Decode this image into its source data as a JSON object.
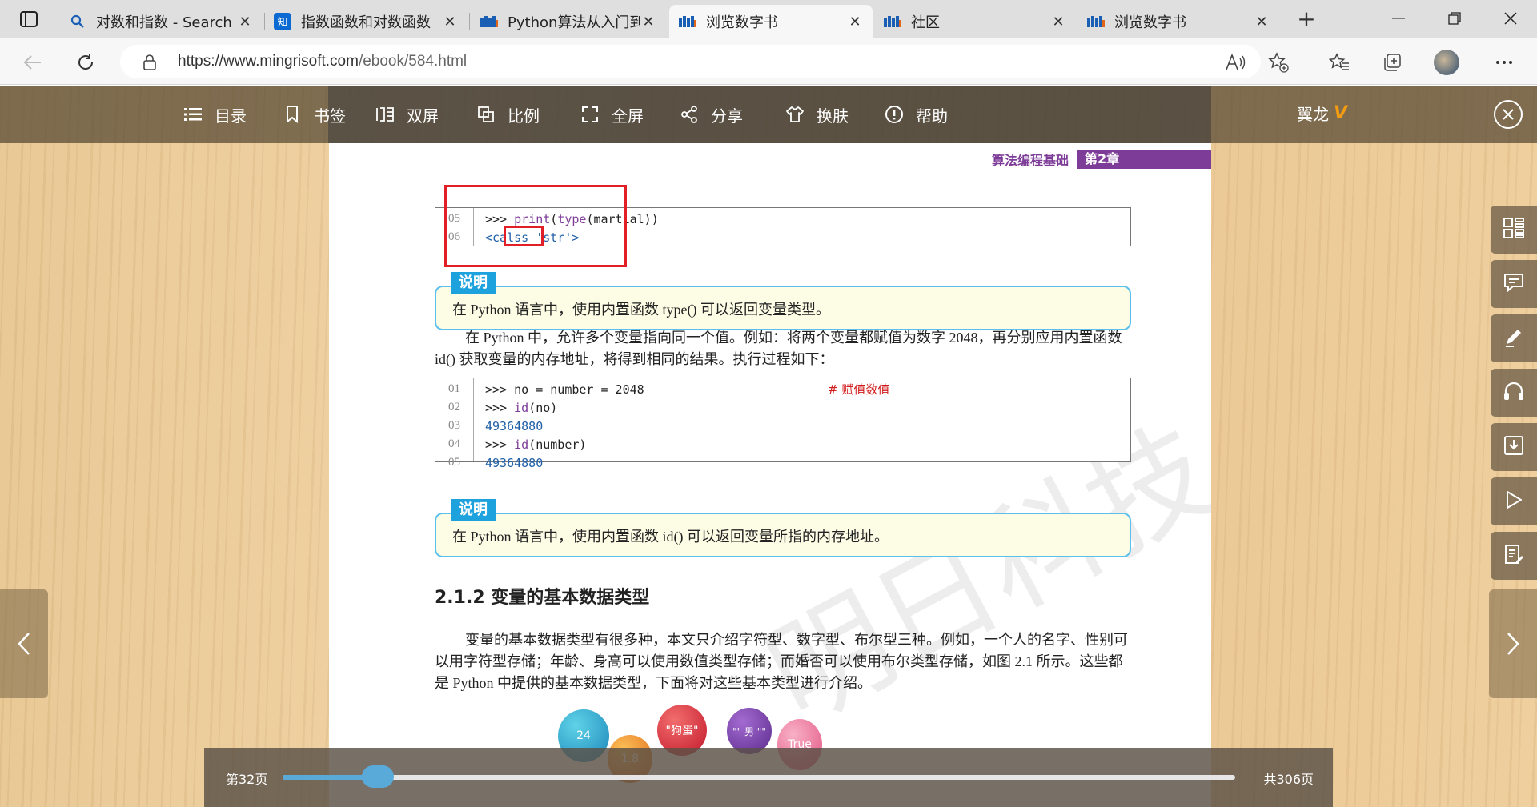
{
  "browser": {
    "tabs": [
      {
        "title": "对数和指数 - Search",
        "favicon": "search-icon",
        "active": false
      },
      {
        "title": "指数函数和对数函数",
        "favicon": "zhihu-icon",
        "active": false
      },
      {
        "title": "Python算法从入门到",
        "favicon": "mingri-icon",
        "active": false
      },
      {
        "title": "浏览数字书",
        "favicon": "mingri-icon",
        "active": true
      },
      {
        "title": "社区",
        "favicon": "mingri-icon",
        "active": false
      },
      {
        "title": "浏览数字书",
        "favicon": "mingri-icon",
        "active": false
      }
    ],
    "url_host": "https://www.mingrisoft.com",
    "url_path": "/ebook/584.html",
    "new_tab": "+",
    "tab_close": "✕"
  },
  "toolbar": {
    "items": [
      {
        "label": "目录",
        "icon": "list-icon"
      },
      {
        "label": "书签",
        "icon": "bookmark-icon"
      },
      {
        "label": "双屏",
        "icon": "dual-screen-icon"
      },
      {
        "label": "比例",
        "icon": "scale-icon"
      },
      {
        "label": "全屏",
        "icon": "fullscreen-icon"
      },
      {
        "label": "分享",
        "icon": "share-icon"
      },
      {
        "label": "换肤",
        "icon": "skin-icon"
      },
      {
        "label": "帮助",
        "icon": "help-icon"
      }
    ],
    "brand": "翼龙",
    "brand_logo": "V"
  },
  "page": {
    "header_sub": "算法编程基础",
    "header_chapter": "第2章",
    "code1": [
      {
        "num": "05",
        "segments": [
          [
            ">>> ",
            ""
          ],
          [
            "print",
            "kw"
          ],
          [
            "(",
            ""
          ],
          [
            "type",
            "kw"
          ],
          [
            "(martial))",
            ""
          ]
        ]
      },
      {
        "num": "06",
        "segments": [
          [
            "<calss ",
            "blue"
          ],
          [
            "'str'>",
            "blue"
          ]
        ]
      }
    ],
    "note1_tag": "说明",
    "note1_text": "在 Python 语言中，使用内置函数 type() 可以返回变量类型。",
    "para1": "在 Python 中，允许多个变量指向同一个值。例如：将两个变量都赋值为数字 2048，再分别应用内置函数 id() 获取变量的内存地址，将得到相同的结果。执行过程如下：",
    "code2": [
      {
        "num": "01",
        "segments": [
          [
            ">>> no = number = 2048",
            ""
          ]
        ],
        "comment": "# 赋值数值"
      },
      {
        "num": "02",
        "segments": [
          [
            ">>> ",
            ""
          ],
          [
            "id",
            "kw"
          ],
          [
            "(no)",
            ""
          ]
        ]
      },
      {
        "num": "03",
        "segments": [
          [
            "49364880",
            "blue"
          ]
        ]
      },
      {
        "num": "04",
        "segments": [
          [
            ">>> ",
            ""
          ],
          [
            "id",
            "kw"
          ],
          [
            "(number)",
            ""
          ]
        ]
      },
      {
        "num": "05",
        "segments": [
          [
            "49364880",
            "blue"
          ]
        ]
      }
    ],
    "note2_tag": "说明",
    "note2_text": "在 Python 语言中，使用内置函数 id() 可以返回变量所指的内存地址。",
    "section_title": "2.1.2  变量的基本数据类型",
    "para2": "变量的基本数据类型有很多种，本文只介绍字符型、数字型、布尔型三种。例如，一个人的名字、性别可以用字符型存储；年龄、身高可以使用数值类型存储；而婚否可以使用布尔类型存储，如图 2.1 所示。这些都是 Python 中提供的基本数据类型，下面将对这些基本类型进行介绍。",
    "balloons": [
      "24",
      "1.8",
      "\"狗蛋\"",
      "\"\" 男 \"\"",
      "True"
    ],
    "watermark": "明日科技"
  },
  "progress": {
    "current": "第32页",
    "total": "共306页",
    "fraction": 0.1
  },
  "side_tools": [
    "grid-icon",
    "comment-icon",
    "pen-icon",
    "headphones-icon",
    "download-icon",
    "play-icon",
    "notes-icon"
  ]
}
